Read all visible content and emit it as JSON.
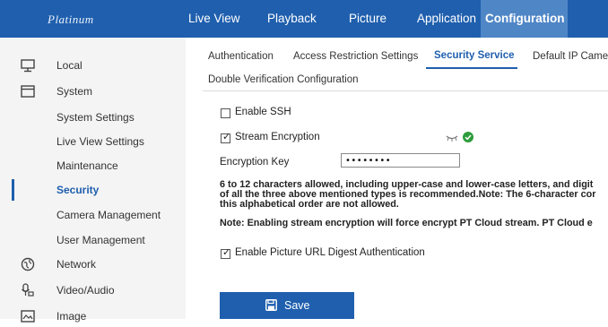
{
  "brand": {
    "logo_text": "Platinum"
  },
  "topnav": {
    "items": [
      "Live View",
      "Playback",
      "Picture",
      "Application",
      "Configuration"
    ],
    "active": "Configuration"
  },
  "sidebar": {
    "items": [
      {
        "label": "Local",
        "icon": "monitor-icon"
      },
      {
        "label": "System",
        "icon": "window-icon"
      },
      {
        "label": "System Settings"
      },
      {
        "label": "Live View Settings"
      },
      {
        "label": "Maintenance"
      },
      {
        "label": "Security",
        "active": true
      },
      {
        "label": "Camera Management"
      },
      {
        "label": "User Management"
      },
      {
        "label": "Network",
        "icon": "globe-icon"
      },
      {
        "label": "Video/Audio",
        "icon": "microphone-camera-icon"
      },
      {
        "label": "Image",
        "icon": "image-icon"
      }
    ]
  },
  "tabs": {
    "items": [
      "Authentication",
      "Access Restriction Settings",
      "Security Service",
      "Default IP Came",
      "Double Verification Configuration"
    ],
    "active": "Security Service"
  },
  "form": {
    "enable_ssh": {
      "label": "Enable SSH",
      "checked": false
    },
    "stream_encryption": {
      "label": "Stream Encryption",
      "checked": true
    },
    "encryption_key": {
      "label": "Encryption Key",
      "value": "••••••••"
    },
    "password_note_line1": "6 to 12 characters allowed, including upper-case and lower-case letters, and digit",
    "password_note_line2": "of all the three above mentioned types is recommended.Note: The 6-character cor",
    "password_note_line3": "this alphabetical order are not allowed.",
    "cloud_note": "Note: Enabling stream encryption will force encrypt PT Cloud stream. PT Cloud e",
    "picture_url_digest": {
      "label": "Enable Picture URL Digest Authentication",
      "checked": true
    },
    "save_label": "Save"
  },
  "colors": {
    "brand_blue": "#1f5fae",
    "active_nav": "#4f86c6",
    "sidebar_bg": "#f4f4f4",
    "ok_green": "#2e9c3c"
  }
}
